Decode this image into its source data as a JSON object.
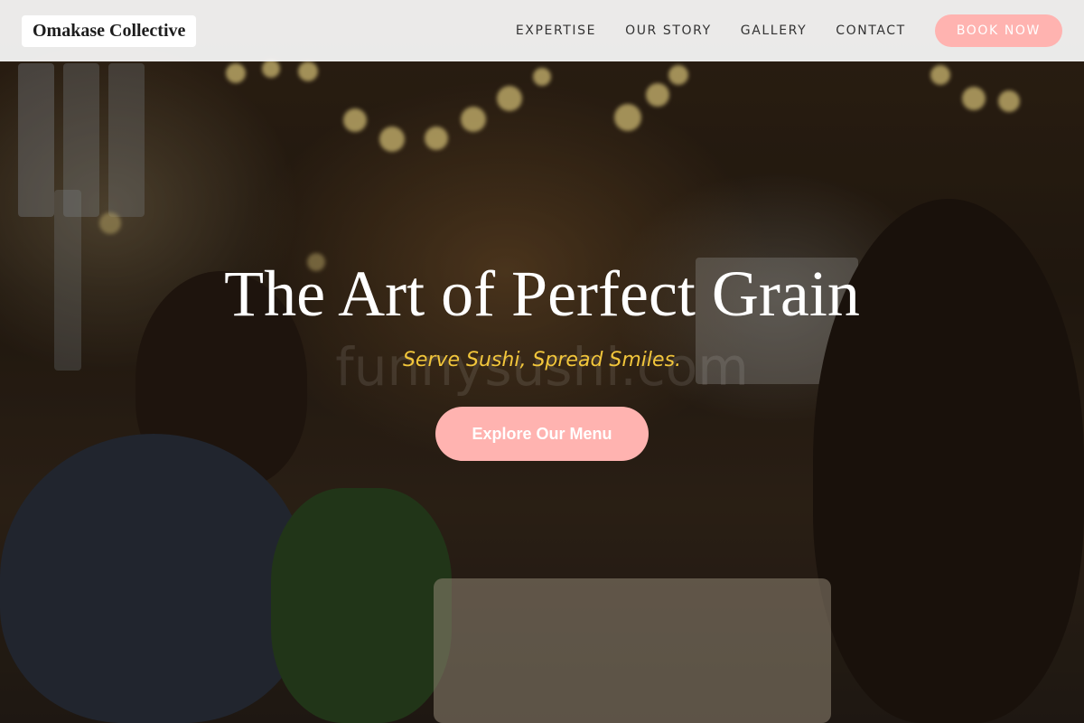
{
  "brand": {
    "name": "Omakase Collective"
  },
  "nav": {
    "links": [
      "EXPERTISE",
      "OUR STORY",
      "GALLERY",
      "CONTACT"
    ],
    "book_label": "BOOK NOW"
  },
  "hero": {
    "headline": "The Art of Perfect Grain",
    "tagline": "Serve Sushi, Spread Smiles.",
    "cta_label": "Explore Our Menu",
    "watermark": "funnysushi.com"
  },
  "colors": {
    "accent": "#ffb3b0",
    "tagline": "#f2c63b",
    "nav_background": "#fafafa"
  }
}
